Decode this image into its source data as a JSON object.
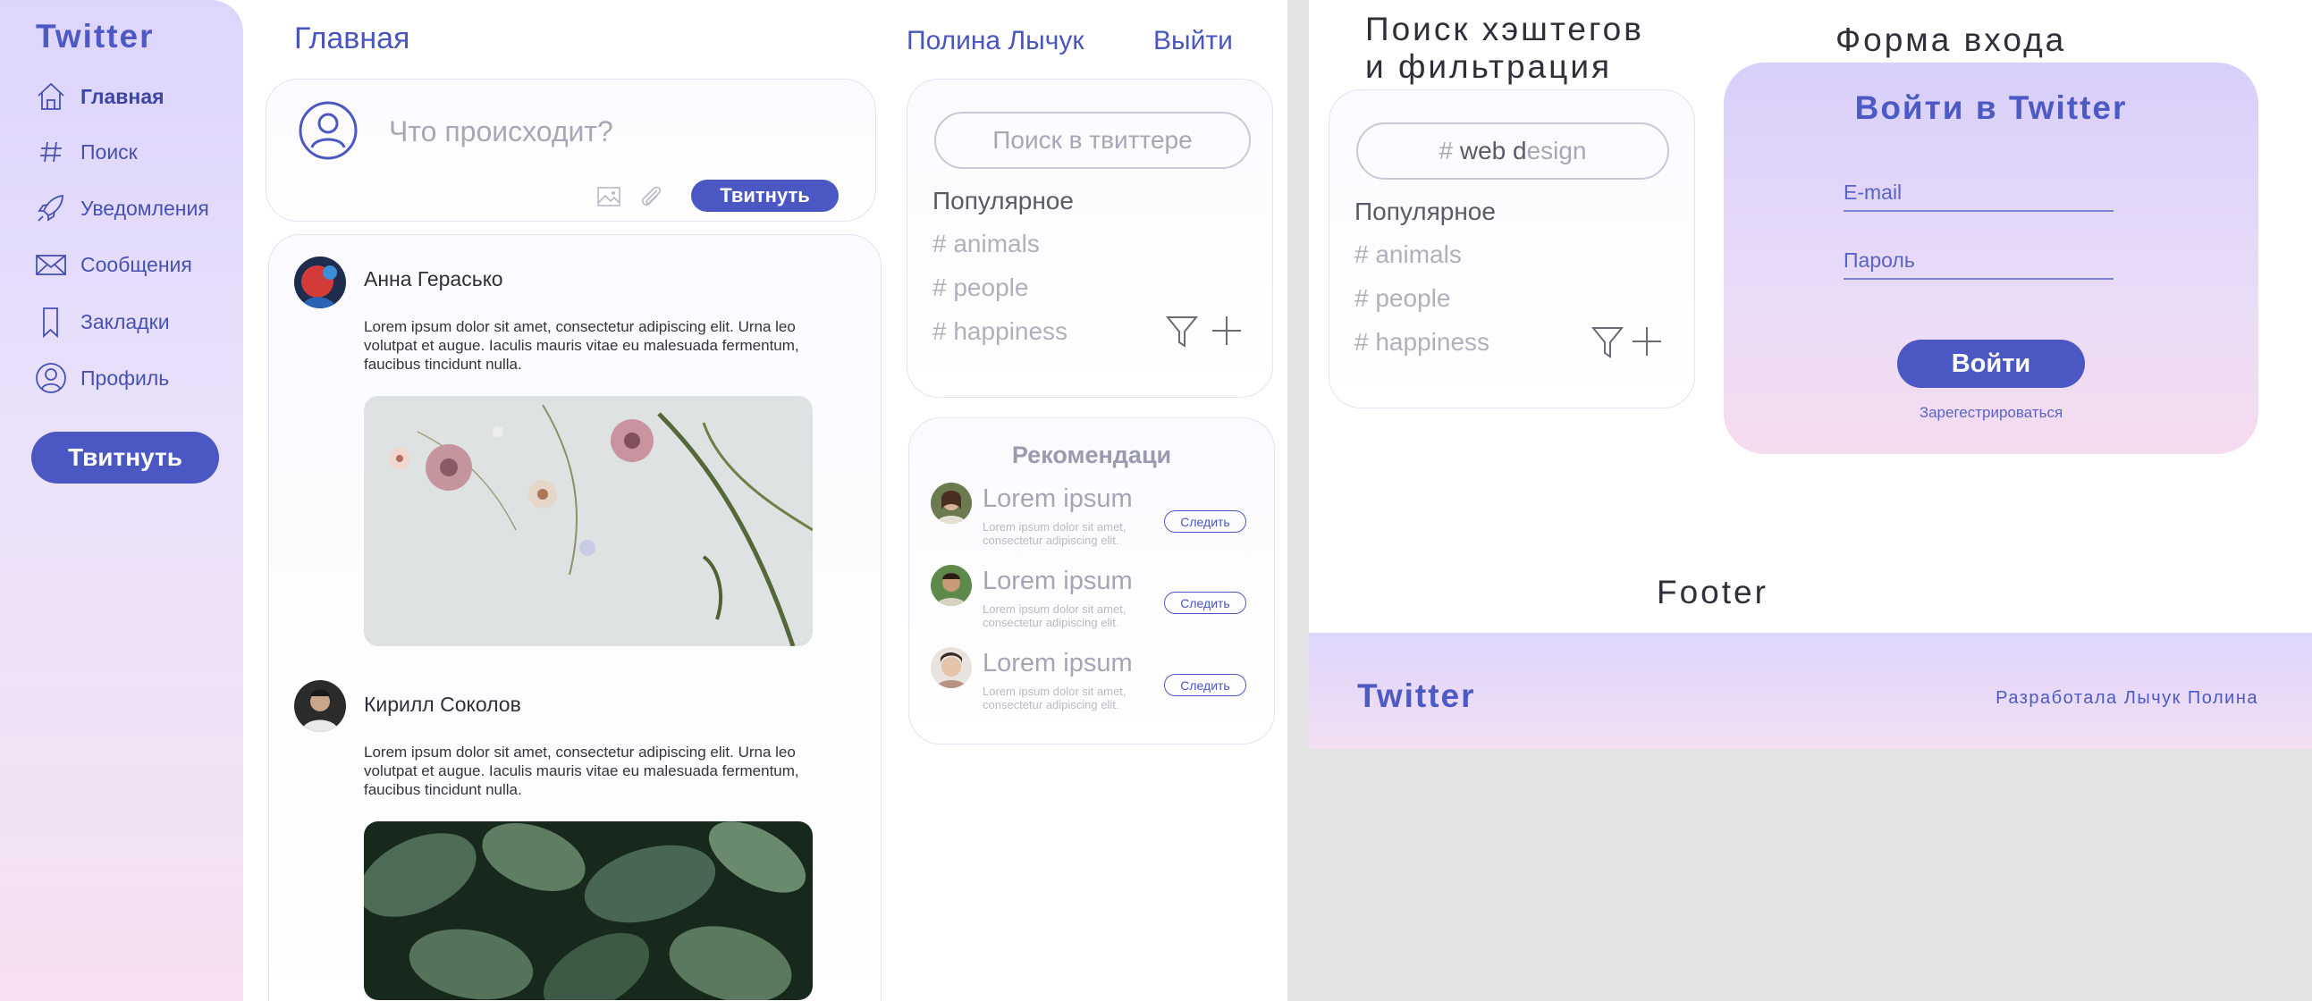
{
  "sidebar": {
    "brand": "Twitter",
    "items": [
      {
        "label": "Главная",
        "icon": "home-icon"
      },
      {
        "label": "Поиск",
        "icon": "hash-icon"
      },
      {
        "label": "Уведомления",
        "icon": "rocket-icon"
      },
      {
        "label": "Сообщения",
        "icon": "mail-icon"
      },
      {
        "label": "Закладки",
        "icon": "bookmark-icon"
      },
      {
        "label": "Профиль",
        "icon": "profile-icon"
      }
    ],
    "tweet_button": "Твитнуть"
  },
  "header": {
    "title": "Главная",
    "user": "Полина Лычук",
    "logout": "Выйти"
  },
  "compose": {
    "placeholder": "Что происходит?",
    "tweet_button": "Твитнуть"
  },
  "feed": {
    "posts": [
      {
        "author": "Анна Гераськo",
        "text": "Lorem ipsum dolor sit amet, consectetur adipiscing elit. Urna leo volutpat et augue. Iaculis mauris vitae eu malesuada fermentum, faucibus tincidunt nulla."
      },
      {
        "author": "Кирилл Соколов",
        "text": "Lorem ipsum dolor sit amet, consectetur adipiscing elit. Urna leo volutpat et augue. Iaculis mauris vitae eu malesuada fermentum, faucibus tincidunt nulla."
      }
    ]
  },
  "search": {
    "placeholder": "Поиск в твиттере",
    "popular_title": "Популярное",
    "tags": [
      "animals",
      "people",
      "happiness"
    ]
  },
  "recommendations": {
    "title": "Рекомендаци",
    "items": [
      {
        "name": "Lorem ipsum",
        "desc": "Lorem ipsum dolor sit amet, consectetur adipiscing elit.",
        "follow": "Следить"
      },
      {
        "name": "Lorem ipsum",
        "desc": "Lorem ipsum dolor sit amet, consectetur adipiscing elit.",
        "follow": "Следить"
      },
      {
        "name": "Lorem ipsum",
        "desc": "Lorem ipsum dolor sit amet, consectetur adipiscing elit.",
        "follow": "Следить"
      }
    ]
  },
  "filter_section": {
    "title_line1": "Поиск хэштегов",
    "title_line2": "и фильтрация",
    "query_typed": "web d",
    "query_rest": "esign",
    "popular_title": "Популярное",
    "tags": [
      "animals",
      "people",
      "happiness"
    ]
  },
  "login_section": {
    "title": "Форма входа",
    "card_title": "Войти в Twitter",
    "email_label": "E-mail",
    "password_label": "Пароль",
    "submit": "Войти",
    "register": "Зарегестрироваться"
  },
  "footer_section": {
    "title": "Footer",
    "brand": "Twitter",
    "credit": "Разработала Лычук Полина"
  },
  "colors": {
    "accent": "#4b57c2",
    "sidebar_top": "#ddd5fc",
    "sidebar_bottom": "#f6e0f1"
  }
}
